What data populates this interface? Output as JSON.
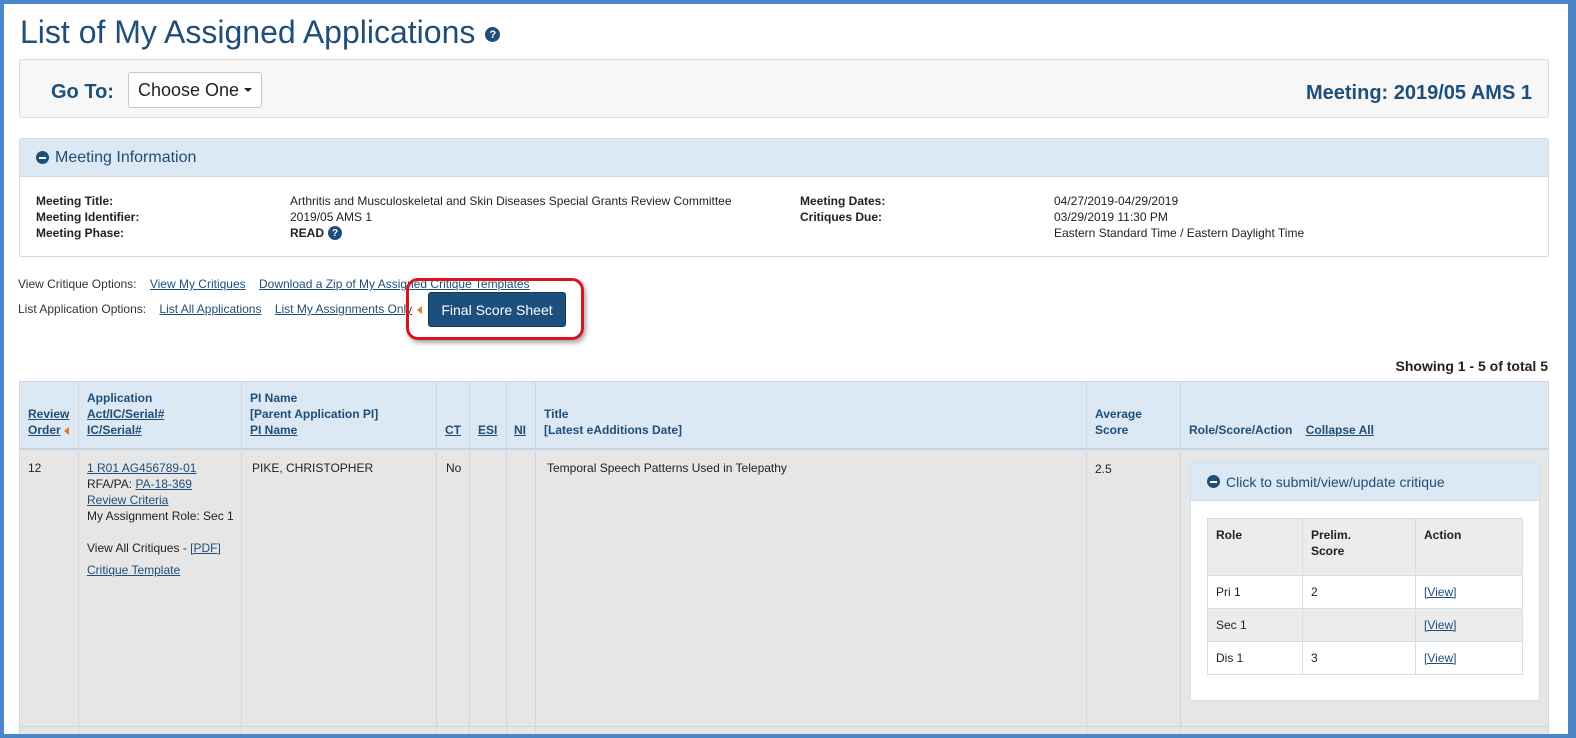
{
  "page": {
    "title": "List of My Assigned Applications",
    "help_glyph": "?"
  },
  "goto": {
    "label": "Go To:",
    "selected": "Choose One",
    "meeting": "Meeting: 2019/05 AMS 1"
  },
  "meeting_info": {
    "header": "Meeting Information",
    "left": [
      {
        "label": "Meeting Title:",
        "value": "Arthritis and Musculoskeletal and Skin Diseases Special Grants Review Committee"
      },
      {
        "label": "Meeting Identifier:",
        "value": "2019/05 AMS 1"
      },
      {
        "label": "Meeting Phase:",
        "value": "READ"
      }
    ],
    "right": [
      {
        "label": "Meeting Dates:",
        "value": "04/27/2019-04/29/2019"
      },
      {
        "label": "Critiques Due:",
        "value": "03/29/2019 11:30 PM"
      },
      {
        "label": "",
        "value": "Eastern Standard Time / Eastern Daylight Time"
      }
    ]
  },
  "options": {
    "critique_label": "View Critique Options:",
    "view_my_critiques": "View My Critiques",
    "download_zip": "Download a Zip of My Assigned Critique Templates",
    "list_label": "List Application Options:",
    "list_all": "List All Applications",
    "list_mine": "List My Assignments Only",
    "final_score_sheet": "Final Score Sheet"
  },
  "showing": "Showing 1 - 5 of total 5",
  "table": {
    "headers": {
      "review_order_1": "Review",
      "review_order_2": "Order",
      "application": "Application",
      "act_ic_serial": "Act/IC/Serial#",
      "ic_serial": "IC/Serial#",
      "pi_name": "PI Name",
      "parent_pi": "[Parent Application PI]",
      "pi_name_link": "PI Name",
      "ct": "CT",
      "esi": "ESI",
      "ni": "NI",
      "title": "Title",
      "latest_eadd": "[Latest eAdditions Date]",
      "avg_score_1": "Average",
      "avg_score_2": "Score",
      "role_score_action": "Role/Score/Action",
      "collapse_all": "Collapse All"
    },
    "row1": {
      "order": "12",
      "app_number": "1 R01 AG456789-01",
      "rfa_label": "RFA/PA:",
      "rfa_value": "PA-18-369",
      "review_criteria": "Review Criteria",
      "assignment_role": "My Assignment Role: Sec 1",
      "view_all_critiques": "View All Critiques - ",
      "pdf": "[PDF]",
      "critique_template": "Critique Template",
      "pi": "PIKE, CHRISTOPHER",
      "ct": "No",
      "title": "Temporal Speech Patterns Used in Telepathy",
      "avg_score": "2.5",
      "critique_panel_header": "Click to submit/view/update critique",
      "roles_header": {
        "role": "Role",
        "prelim_1": "Prelim.",
        "prelim_2": "Score",
        "action": "Action"
      },
      "roles": [
        {
          "role": "Pri 1",
          "score": "2",
          "action": "[View]"
        },
        {
          "role": "Sec 1",
          "score": "",
          "action": "[View]"
        },
        {
          "role": "Dis 1",
          "score": "3",
          "action": "[View]"
        }
      ]
    }
  }
}
